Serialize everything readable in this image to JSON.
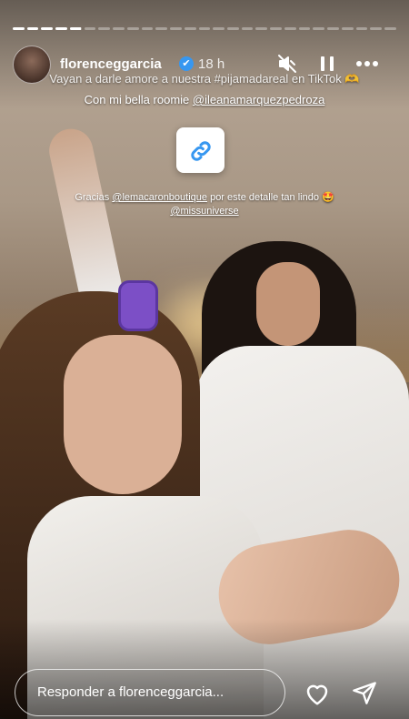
{
  "story": {
    "progress": [
      1,
      1,
      1,
      1,
      0.95,
      0,
      0,
      0,
      0,
      0,
      0,
      0,
      0,
      0,
      0,
      0,
      0,
      0,
      0,
      0,
      0,
      0,
      0,
      0,
      0,
      0,
      0
    ]
  },
  "header": {
    "username": "florenceggarcia",
    "verified_mark": "✔",
    "time": "18 h"
  },
  "captions": {
    "line1": "Vayan a darle amore a nuestra #pijamadareal en TikTok 🫶",
    "line2_text": "Con mi bella roomie ",
    "line2_mention": "@ileanamarquezpedroza",
    "line3_text": "Gracias ",
    "line3_mention1": "@lemacaronboutique",
    "line3_rest": " por este detalle tan lindo 🤩",
    "line4_mention": "@missuniverse"
  },
  "reply": {
    "placeholder": "Responder a florenceggarcia..."
  },
  "icons": {
    "mute": "speaker-muted-icon",
    "pause": "pause-icon",
    "more": "more-icon",
    "link": "link-icon",
    "heart": "heart-icon",
    "send": "send-icon"
  },
  "colors": {
    "verified": "#3797f0",
    "link": "#3797f0"
  }
}
